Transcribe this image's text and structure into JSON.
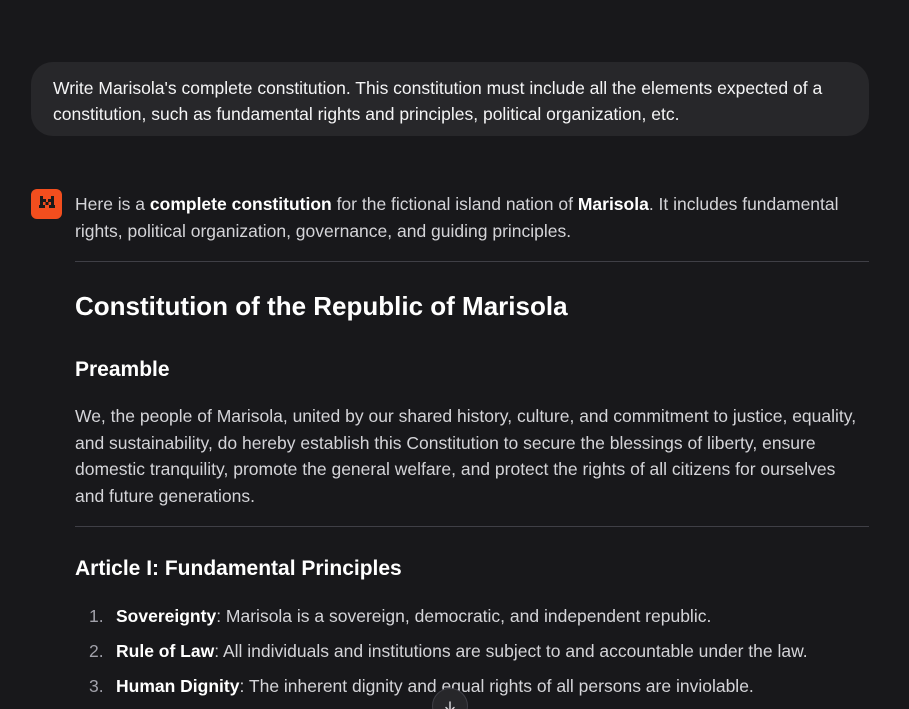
{
  "user_message": {
    "text": "Write Marisola's complete constitution. This constitution must include all the elements expected of a constitution, such as fundamental rights and principles, political organization, etc."
  },
  "assistant": {
    "avatar_icon": "mistral-logo-icon",
    "avatar_color": "#f24e1e",
    "intro": {
      "part1": "Here is a ",
      "bold1": "complete constitution",
      "part2": " for the fictional island nation of ",
      "bold2": "Marisola",
      "part3": ". It includes fundamental rights, political organization, governance, and guiding principles."
    },
    "title": "Constitution of the Republic of Marisola",
    "preamble": {
      "heading": "Preamble",
      "text": "We, the people of Marisola, united by our shared history, culture, and commitment to justice, equality, and sustainability, do hereby establish this Constitution to secure the blessings of liberty, ensure domestic tranquility, promote the general welfare, and protect the rights of all citizens for ourselves and future generations."
    },
    "article1": {
      "heading": "Article I: Fundamental Principles",
      "items": [
        {
          "num": "1.",
          "term": "Sovereignty",
          "desc": ": Marisola is a sovereign, democratic, and independent republic."
        },
        {
          "num": "2.",
          "term": "Rule of Law",
          "desc": ": All individuals and institutions are subject to and accountable under the law."
        },
        {
          "num": "3.",
          "term": "Human Dignity",
          "desc": ": The inherent dignity and equal rights of all persons are inviolable."
        }
      ]
    }
  },
  "scroll_button": {
    "icon": "arrow-down-icon"
  }
}
